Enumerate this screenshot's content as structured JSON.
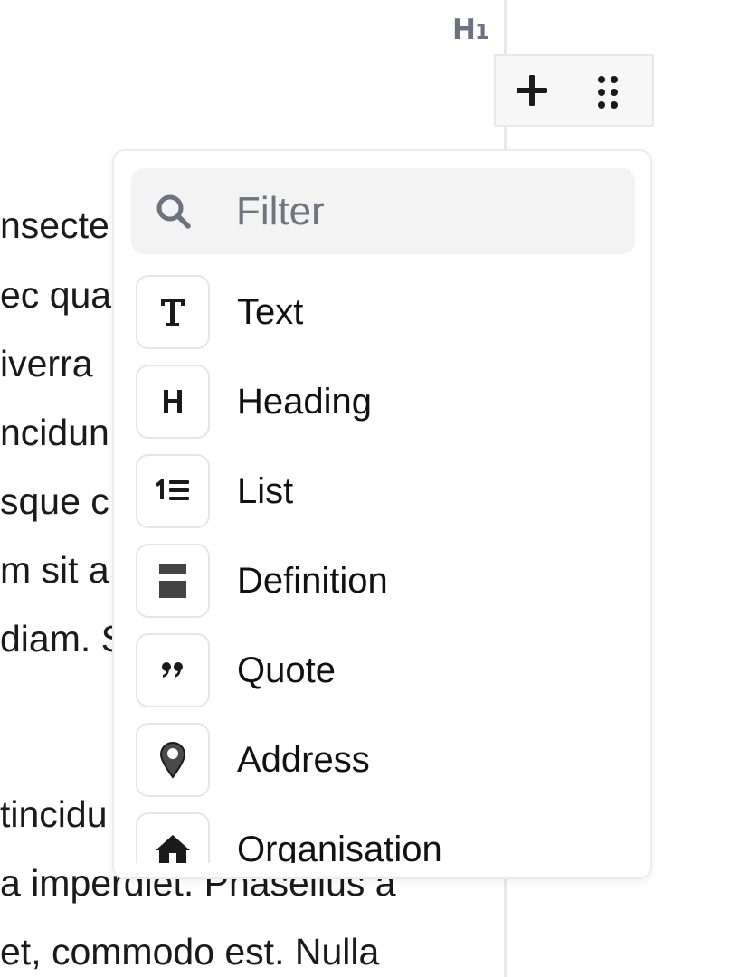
{
  "heading_indicator": {
    "letter": "H",
    "level": "1"
  },
  "block_toolbar": {
    "add_icon": "plus-icon",
    "drag_icon": "drag-handle-dots-icon"
  },
  "body_text": {
    "lines": [
      "nsecte",
      "ec qua",
      "iverra",
      "ncidun",
      "sque c",
      "m sit a",
      "diam. S",
      "",
      " tincidu",
      "a imperdiet. Phasellus a",
      "et, commodo est. Nulla"
    ]
  },
  "block_menu": {
    "filter": {
      "icon": "search-icon",
      "placeholder": "Filter",
      "value": ""
    },
    "items": [
      {
        "label": "Text",
        "icon": "text-type-icon"
      },
      {
        "label": "Heading",
        "icon": "heading-icon"
      },
      {
        "label": "List",
        "icon": "ordered-list-icon"
      },
      {
        "label": "Definition",
        "icon": "definition-icon"
      },
      {
        "label": "Quote",
        "icon": "quote-icon"
      },
      {
        "label": "Address",
        "icon": "map-pin-icon"
      },
      {
        "label": "Organisation",
        "icon": "house-icon"
      }
    ]
  },
  "colors": {
    "muted_text": "#6b7280",
    "border": "#e8e8e8",
    "filter_background": "#f3f3f3",
    "icon_dark": "#1a1a1a"
  }
}
